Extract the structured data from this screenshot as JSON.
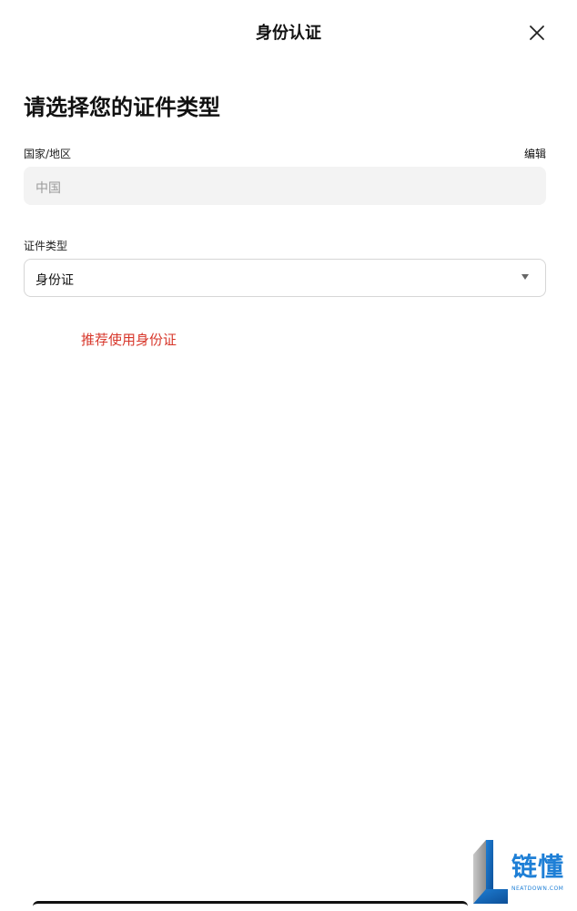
{
  "header": {
    "title": "身份认证",
    "close_icon": "close-icon"
  },
  "page": {
    "title": "请选择您的证件类型"
  },
  "country": {
    "label": "国家/地区",
    "edit_label": "编辑",
    "value": "中国"
  },
  "id_type": {
    "label": "证件类型",
    "selected": "身份证",
    "dropdown_icon": "chevron-down-icon"
  },
  "hint": "推荐使用身份证",
  "watermark": {
    "main": "链懂",
    "sub": "NEATDOWN.COM"
  },
  "colors": {
    "hint_red": "#d7362a",
    "field_bg": "#f3f3f3",
    "watermark_blue": "#1e7fd6"
  }
}
